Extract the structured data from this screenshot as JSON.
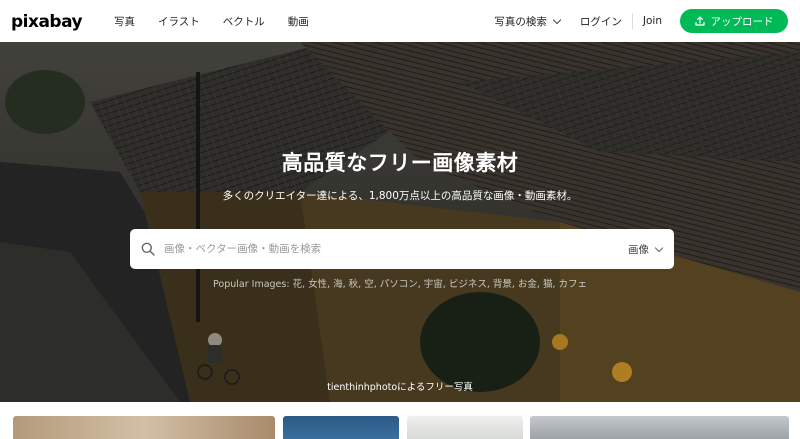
{
  "header": {
    "logo": "pixabay",
    "nav": [
      {
        "label": "写真"
      },
      {
        "label": "イラスト"
      },
      {
        "label": "ベクトル"
      },
      {
        "label": "動画"
      }
    ],
    "explore_label": "写真の検索",
    "login_label": "ログイン",
    "join_label": "Join",
    "upload_label": "アップロード",
    "accent_color": "#00b957"
  },
  "hero": {
    "title": "高品質なフリー画像素材",
    "subtitle": "多くのクリエイター達による、1,800万点以上の高品質な画像・動画素材。",
    "search": {
      "placeholder": "画像・ベクター画像・動画を検索",
      "type_label": "画像"
    },
    "popular_text": "Popular Images: 花, 女性, 海, 秋, 空, パソコン, 宇宙, ビジネス, 背景, お金, 猫, カフェ",
    "credit_text": "tienthinhphotoによるフリー写真"
  },
  "thumbnails": [
    {
      "color": "#c9b59a"
    },
    {
      "color": "#2b5a86"
    },
    {
      "color": "#e8e8e6"
    },
    {
      "color": "#b9bcc0"
    }
  ]
}
